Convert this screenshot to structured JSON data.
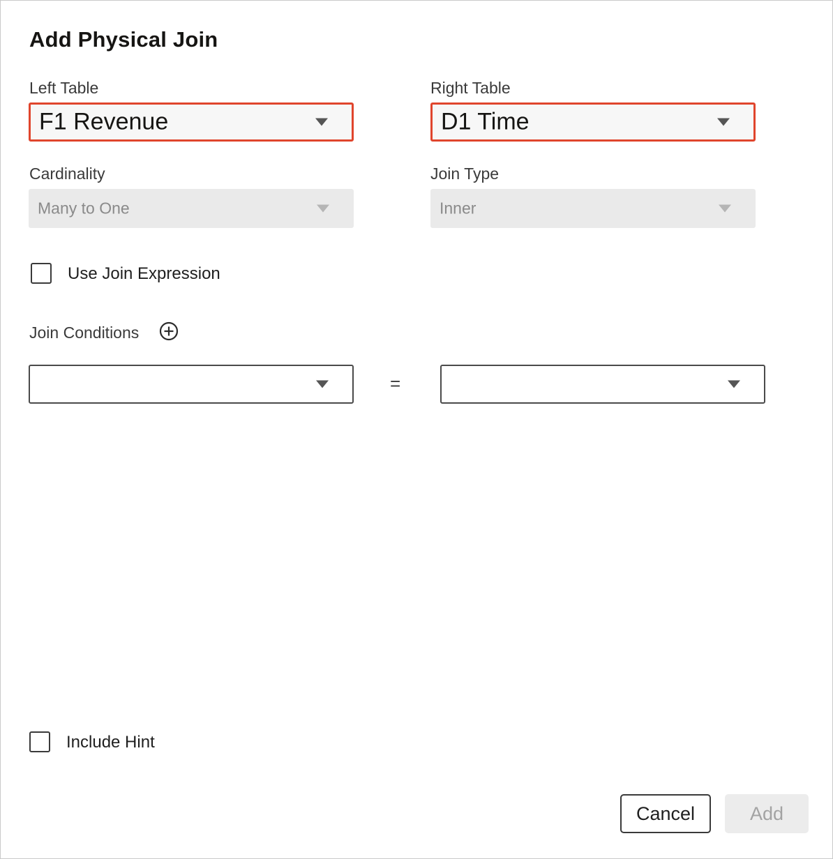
{
  "dialog": {
    "title": "Add Physical Join"
  },
  "left_table": {
    "label": "Left Table",
    "value": "F1 Revenue"
  },
  "right_table": {
    "label": "Right Table",
    "value": "D1 Time"
  },
  "cardinality": {
    "label": "Cardinality",
    "value": "Many to One"
  },
  "join_type": {
    "label": "Join Type",
    "value": "Inner"
  },
  "use_join_expression": {
    "label": "Use Join Expression",
    "checked": false
  },
  "join_conditions": {
    "label": "Join Conditions",
    "operator": "=",
    "left_column": "",
    "right_column": ""
  },
  "include_hint": {
    "label": "Include Hint",
    "checked": false
  },
  "buttons": {
    "cancel": "Cancel",
    "add": "Add"
  },
  "icons": {
    "add_condition": "plus-circle-icon",
    "dropdown": "caret-down-icon"
  },
  "colors": {
    "highlight": "#e0452d",
    "disabled_fill": "#eaeaea"
  }
}
